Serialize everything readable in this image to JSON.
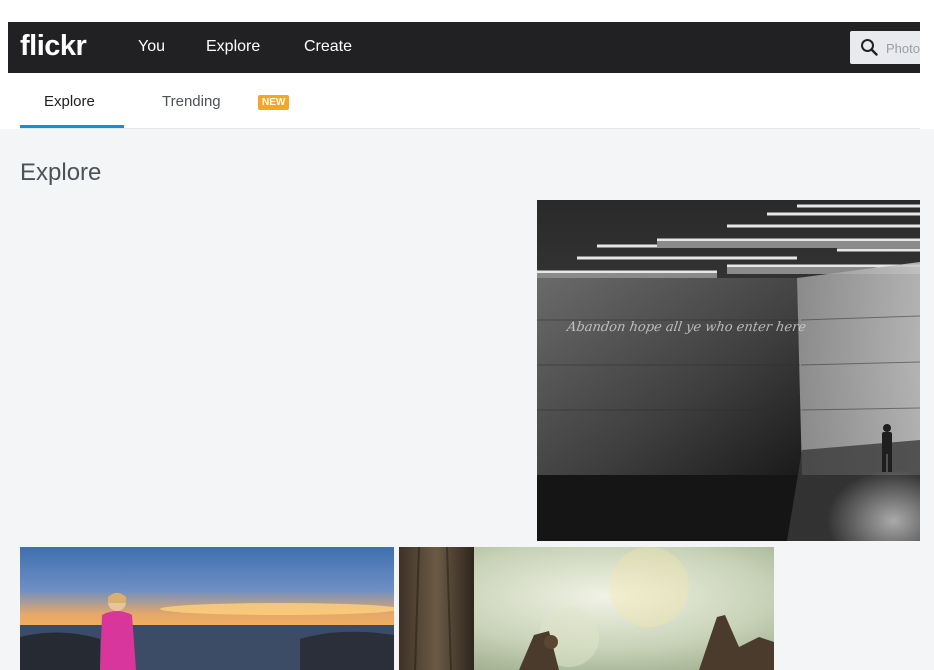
{
  "header": {
    "logo": "flickr",
    "nav": [
      "You",
      "Explore",
      "Create"
    ],
    "search_placeholder": "Photos"
  },
  "subnav": {
    "tabs": [
      "Explore",
      "Trending"
    ],
    "active_tab": "Explore",
    "new_badge": "NEW"
  },
  "main": {
    "title": "Explore",
    "photos": [
      {
        "caption": "Abandon hope all ye who enter here"
      },
      {},
      {}
    ]
  },
  "colors": {
    "topbar": "#212124",
    "accent_blue": "#128fdc",
    "badge_orange": "#f5a623",
    "content_bg": "#f3f5f6"
  },
  "icons": [
    "search-icon"
  ]
}
